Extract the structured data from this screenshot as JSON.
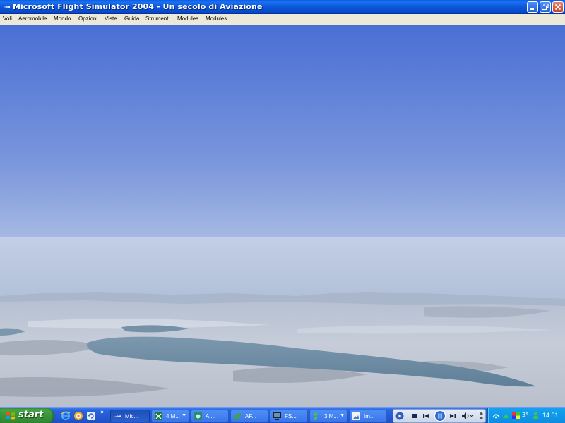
{
  "window": {
    "title": "Microsoft Flight Simulator 2004 - Un secolo di Aviazione",
    "controls": {
      "minimize": "minimize-icon",
      "maximize": "restore-icon",
      "close": "close-icon"
    }
  },
  "menu": {
    "items": [
      {
        "label": "Voli"
      },
      {
        "label": "Aeromobile"
      },
      {
        "label": "Mondo"
      },
      {
        "label": "Opzioni"
      },
      {
        "label": "Viste"
      },
      {
        "label": "Guida"
      },
      {
        "label": "Strumenti"
      },
      {
        "label": "Modules"
      },
      {
        "label": "Modules"
      }
    ]
  },
  "scene": {
    "description_icon": "flight-view",
    "colors": {
      "sky_top": "#4b73d6",
      "sky_bottom": "#c6d4ea",
      "haze": "#b9c7dc",
      "ground": "#c4ccd8",
      "lake": "#6f8ea8"
    }
  },
  "taskbar": {
    "start_label": "start",
    "quick_launch": [
      "ie-icon",
      "media-icon",
      "refresh-icon"
    ],
    "overflow": "»",
    "buttons": [
      {
        "label": "Mic...",
        "icon": "plane-icon",
        "active": true
      },
      {
        "label": "4 M...",
        "icon": "excel-icon",
        "grouped": true
      },
      {
        "label": "AI...",
        "icon": "app-icon"
      },
      {
        "label": "AF...",
        "icon": "leaf-icon"
      },
      {
        "label": "FS...",
        "icon": "monitor-icon"
      },
      {
        "label": "3 M...",
        "icon": "messenger-icon",
        "grouped": true
      },
      {
        "label": "Im...",
        "icon": "image-icon"
      }
    ],
    "media": [
      "play-icon",
      "stop-icon",
      "prev-icon",
      "pause-icon",
      "next-icon",
      "volume-icon"
    ],
    "tray": {
      "icons": [
        "network-icon",
        "wifi-icon",
        "color-icon"
      ],
      "temperature": "3°",
      "time": "14.51"
    }
  }
}
